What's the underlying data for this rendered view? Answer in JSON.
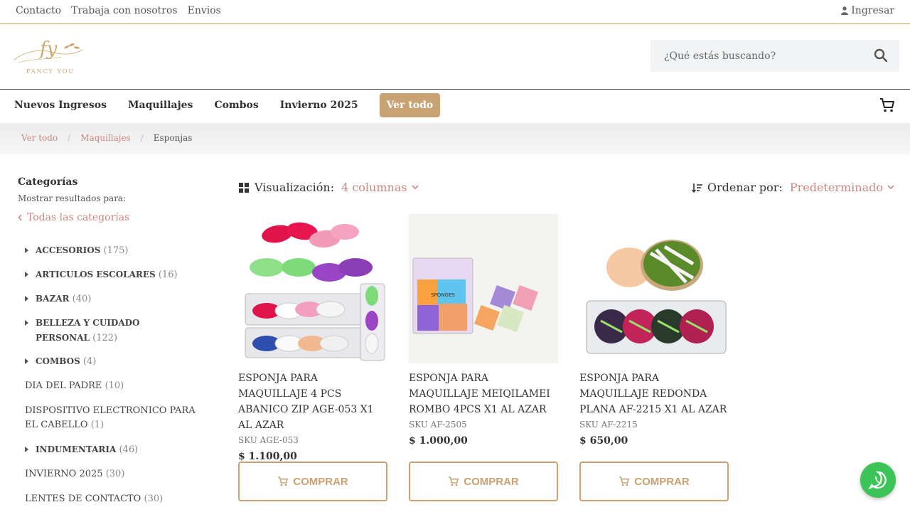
{
  "topbar": {
    "links": [
      "Contacto",
      "Trabaja con nosotros",
      "Envios"
    ],
    "login_label": "Ingresar"
  },
  "header": {
    "logo_monogram": "fy",
    "logo_text": "FANCY YOU",
    "search_placeholder": "¿Qué estás buscando?"
  },
  "nav": {
    "items": [
      "Nuevos Ingresos",
      "Maquillajes",
      "Combos",
      "Invierno 2025"
    ],
    "cta_label": "Ver todo"
  },
  "breadcrumb": {
    "items": [
      "Ver todo",
      "Maquillajes"
    ],
    "current": "Esponjas"
  },
  "sidebar": {
    "title": "Categorías",
    "subtitle": "Mostrar resultados para:",
    "back_label": "Todas las categorías",
    "categories": [
      {
        "name": "ACCESORIOS",
        "count": "(175)"
      },
      {
        "name": "ARTICULOS ESCOLARES",
        "count": "(16)"
      },
      {
        "name": "BAZAR",
        "count": "(40)"
      },
      {
        "name": "BELLEZA Y CUIDADO PERSONAL",
        "count": "(122)"
      },
      {
        "name": "COMBOS",
        "count": "(4)"
      },
      {
        "name": "DIA DEL PADRE",
        "count": "(10)"
      },
      {
        "name": "DISPOSITIVO ELECTRONICO PARA EL CABELLO",
        "count": "(1)"
      },
      {
        "name": "INDUMENTARIA",
        "count": "(46)"
      },
      {
        "name": "INVIERNO 2025",
        "count": "(30)"
      },
      {
        "name": "LENTES DE CONTACTO",
        "count": "(30)"
      }
    ]
  },
  "toolbar": {
    "view_label": "Visualización:",
    "view_value": "4 columnas",
    "order_label": "Ordenar por:",
    "order_value": "Predeterminado"
  },
  "products": [
    {
      "name": "ESPONJA PARA MAQUILLAJE 4 PCS ABANICO ZIP AGE-053 X1 AL AZAR",
      "sku": "SKU AGE-053",
      "price": "$  1.100,00",
      "button": "COMPRAR"
    },
    {
      "name": "ESPONJA PARA MAQUILLAJE MEIQILAMEI ROMBO 4PCS X1 AL AZAR",
      "sku": "SKU AF-2505",
      "price": "$  1.000,00",
      "button": "COMPRAR"
    },
    {
      "name": "ESPONJA PARA MAQUILLAJE REDONDA PLANA AF-2215 X1 AL AZAR",
      "sku": "SKU AF-2215",
      "price": "$  650,00",
      "button": "COMPRAR"
    }
  ],
  "product2_package_text": "SPONGES",
  "colors": {
    "accent_gold": "#c9a274",
    "link_rose": "#c88a82",
    "whatsapp_green": "#3cc556"
  }
}
